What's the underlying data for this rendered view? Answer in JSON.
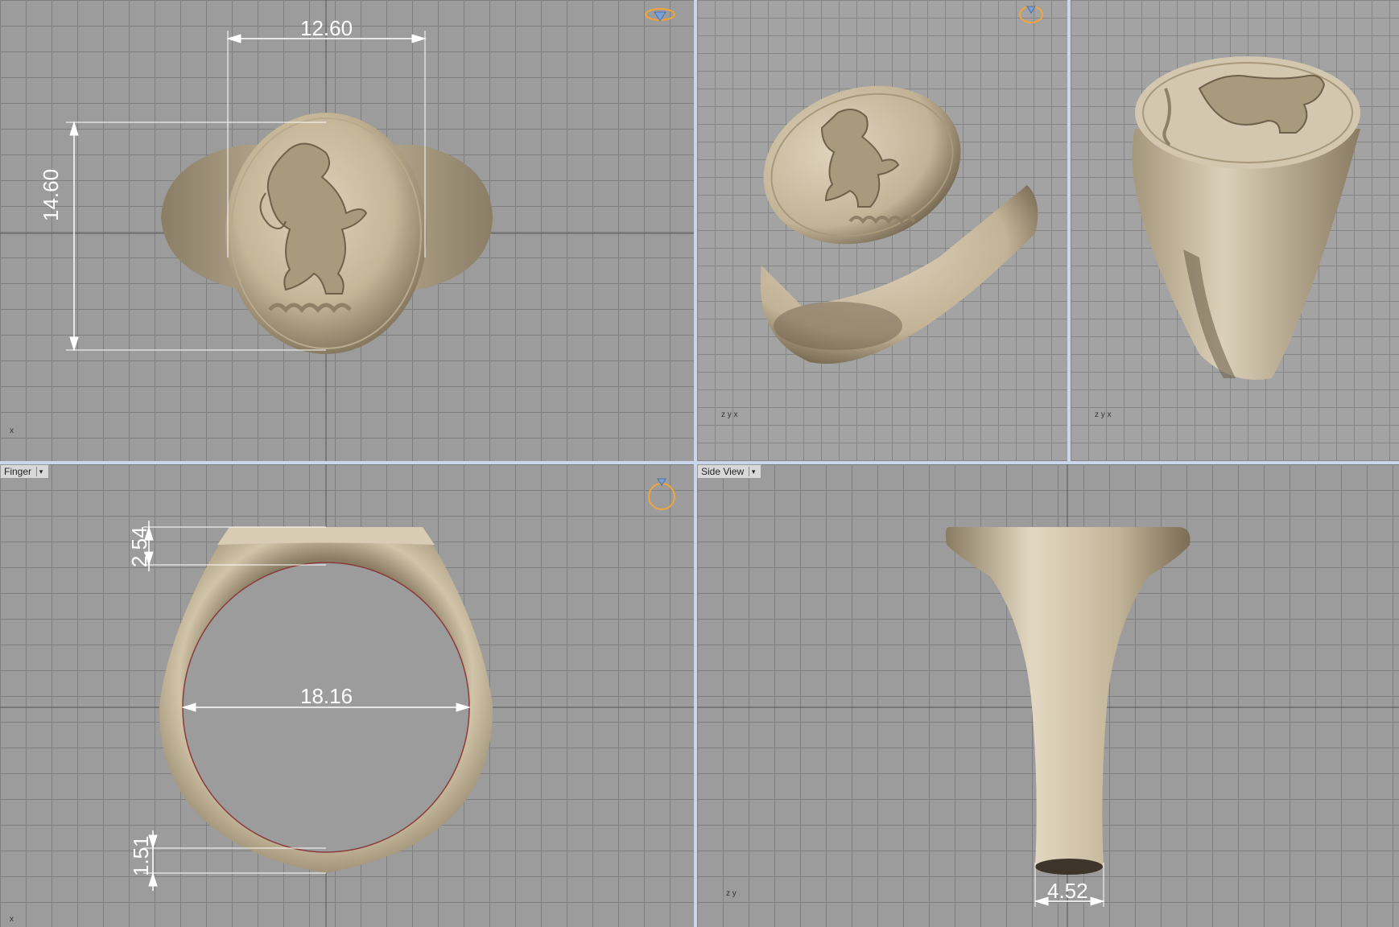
{
  "viewports": {
    "top": {
      "dimensions": {
        "width": "12.60",
        "height": "14.60"
      },
      "axis": "x"
    },
    "perspective": {
      "axis": "z y x"
    },
    "front": {
      "label": "Finger",
      "dimensions": {
        "top_thickness": "2.54",
        "inner_diameter": "18.16",
        "bottom_thickness": "1.51"
      },
      "axis": "x"
    },
    "side": {
      "label": "Side View",
      "dimensions": {
        "shank_width": "4.52"
      },
      "axis": "z y"
    }
  },
  "colors": {
    "ring_metal": "#cdbfa6",
    "grid_line": "#7f7f7f",
    "dimension": "#ffffff",
    "gizmo": "#f2a53a",
    "viewport_separator": "#c9d6ec"
  },
  "icons": [
    "gem-gizmo-icon",
    "orbit-gizmo-icon",
    "ring-gizmo-icon",
    "dropdown-arrow-icon"
  ]
}
